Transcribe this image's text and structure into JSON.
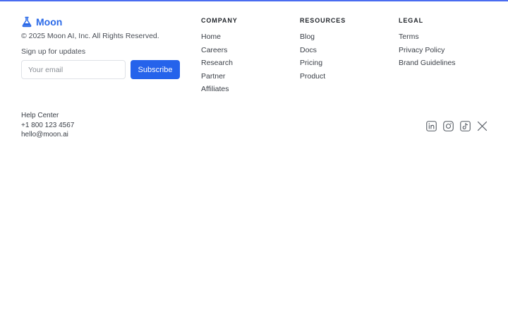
{
  "colors": {
    "accent": "#2563eb",
    "brand": "#2b6ae8",
    "top_bar": "#4a6cf0"
  },
  "brand": {
    "name": "Moon",
    "icon": "moon-flask-icon"
  },
  "copyright": "© 2025 Moon AI, Inc. All Rights Reserved.",
  "signup": {
    "label": "Sign up for updates",
    "placeholder": "Your email",
    "value": "",
    "button_label": "Subscribe"
  },
  "columns": {
    "company": {
      "heading": "COMPANY",
      "links": [
        "Home",
        "Careers",
        "Research",
        "Partner",
        "Affiliates"
      ]
    },
    "resources": {
      "heading": "RESOURCES",
      "links": [
        "Blog",
        "Docs",
        "Pricing",
        "Product"
      ]
    },
    "legal": {
      "heading": "LEGAL",
      "links": [
        "Terms",
        "Privacy Policy",
        "Brand Guidelines"
      ]
    }
  },
  "contact": {
    "help": "Help Center",
    "phone": "+1 800 123 4567",
    "email": "hello@moon.ai"
  },
  "socials": [
    {
      "icon": "linkedin-icon"
    },
    {
      "icon": "instagram-icon"
    },
    {
      "icon": "tiktok-icon"
    },
    {
      "icon": "x-icon"
    }
  ]
}
